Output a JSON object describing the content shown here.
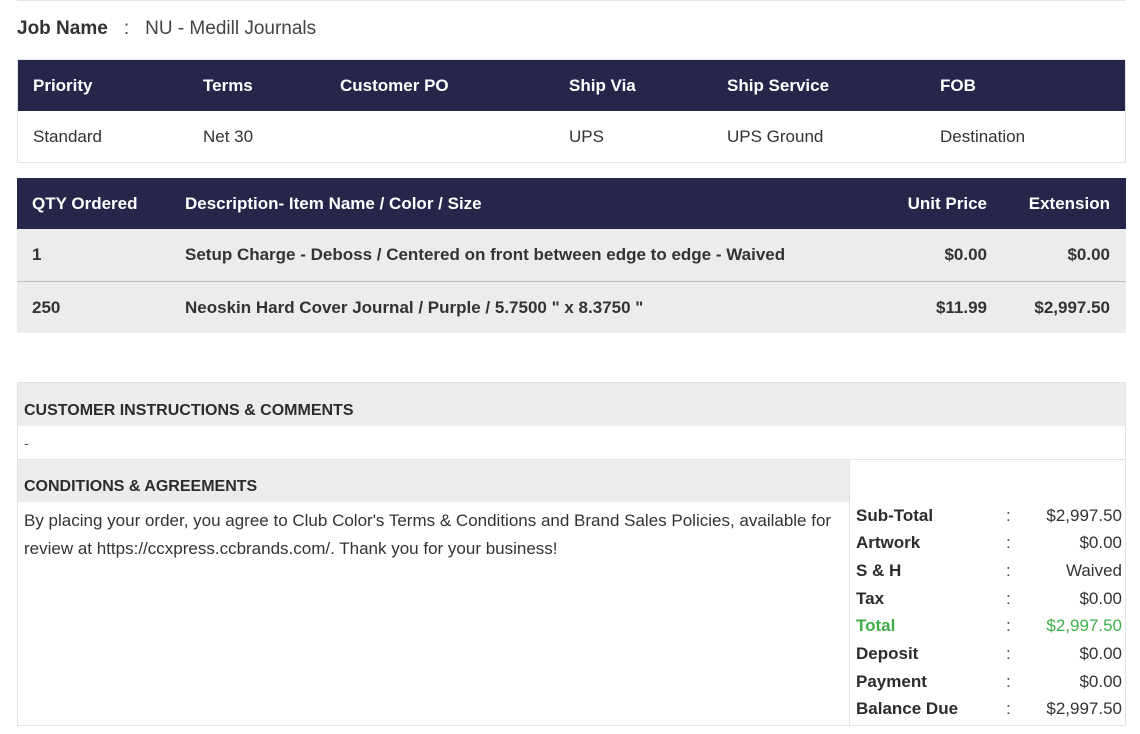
{
  "job": {
    "label": "Job Name",
    "separator": ":",
    "value": "NU - Medill Journals"
  },
  "order_info": {
    "headers": [
      "Priority",
      "Terms",
      "Customer PO",
      "Ship Via",
      "Ship Service",
      "FOB"
    ],
    "values": [
      "Standard",
      "Net 30",
      "",
      "UPS",
      "UPS Ground",
      "Destination"
    ]
  },
  "items": {
    "headers": [
      "QTY Ordered",
      "Description- Item Name / Color / Size",
      "Unit Price",
      "Extension"
    ],
    "rows": [
      {
        "qty": "1",
        "description": "Setup Charge - Deboss / Centered on front between edge to edge - Waived",
        "unit_price": "$0.00",
        "extension": "$0.00"
      },
      {
        "qty": "250",
        "description": "Neoskin Hard Cover Journal / Purple / 5.7500 \" x 8.3750 \"",
        "unit_price": "$11.99",
        "extension": "$2,997.50"
      }
    ]
  },
  "instructions": {
    "title": "CUSTOMER INSTRUCTIONS & COMMENTS",
    "text": "-"
  },
  "conditions": {
    "title": "CONDITIONS & AGREEMENTS",
    "text": "By placing your order, you agree to Club Color's Terms & Conditions and Brand Sales Policies, available for review at https://ccxpress.ccbrands.com/. Thank you for your business!"
  },
  "totals": [
    {
      "label": "Sub-Total",
      "sep": ":",
      "value": "$2,997.50"
    },
    {
      "label": "Artwork",
      "sep": ":",
      "value": "$0.00"
    },
    {
      "label": "S & H",
      "sep": ":",
      "value": "Waived"
    },
    {
      "label": "Tax",
      "sep": ":",
      "value": "$0.00"
    },
    {
      "label": "Total",
      "sep": ":",
      "value": "$2,997.50"
    },
    {
      "label": "Deposit",
      "sep": ":",
      "value": "$0.00"
    },
    {
      "label": "Payment",
      "sep": ":",
      "value": "$0.00"
    },
    {
      "label": "Balance Due",
      "sep": ":",
      "value": "$2,997.50"
    }
  ],
  "colors": {
    "header_bg": "#25264a",
    "total_accent": "#3fae49",
    "row_bg": "#ececec"
  }
}
